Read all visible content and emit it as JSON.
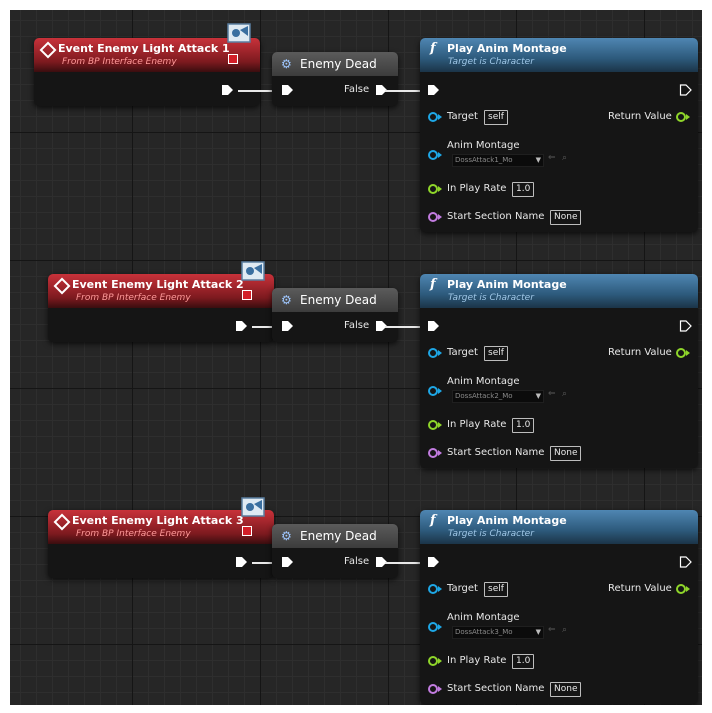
{
  "rows": [
    {
      "event": {
        "title": "Event Enemy Light Attack 1",
        "subtitle": "From BP Interface Enemy"
      },
      "branch": {
        "title": "Enemy Dead",
        "false_label": "False"
      },
      "function": {
        "title": "Play Anim Montage",
        "subtitle": "Target is Character",
        "target_label": "Target",
        "target_value": "self",
        "return_label": "Return Value",
        "anim_label": "Anim Montage",
        "anim_value": "DossAttack1_Mo",
        "rate_label": "In Play Rate",
        "rate_value": "1.0",
        "section_label": "Start Section Name",
        "section_value": "None"
      }
    },
    {
      "event": {
        "title": "Event Enemy Light Attack 2",
        "subtitle": "From BP Interface Enemy"
      },
      "branch": {
        "title": "Enemy Dead",
        "false_label": "False"
      },
      "function": {
        "title": "Play Anim Montage",
        "subtitle": "Target is Character",
        "target_label": "Target",
        "target_value": "self",
        "return_label": "Return Value",
        "anim_label": "Anim Montage",
        "anim_value": "DossAttack2_Mo",
        "rate_label": "In Play Rate",
        "rate_value": "1.0",
        "section_label": "Start Section Name",
        "section_value": "None"
      }
    },
    {
      "event": {
        "title": "Event Enemy Light Attack 3",
        "subtitle": "From BP Interface Enemy"
      },
      "branch": {
        "title": "Enemy Dead",
        "false_label": "False"
      },
      "function": {
        "title": "Play Anim Montage",
        "subtitle": "Target is Character",
        "target_label": "Target",
        "target_value": "self",
        "return_label": "Return Value",
        "anim_label": "Anim Montage",
        "anim_value": "DossAttack3_Mo",
        "rate_label": "In Play Rate",
        "rate_value": "1.0",
        "section_label": "Start Section Name",
        "section_value": "None"
      }
    }
  ],
  "icons": {
    "event": "diamond-event-icon",
    "branch": "gear-icon",
    "function": "function-f-icon",
    "interface": "interface-badge-icon",
    "replicate": "replicate-icon"
  },
  "colors": {
    "event_header": "#c8323a",
    "function_header": "#4f86b2",
    "branch_header": "#5b5b5b",
    "pin_object": "#1ea7e6",
    "pin_float": "#8fd62a",
    "pin_name": "#c27ce0",
    "exec": "#ffffff"
  }
}
